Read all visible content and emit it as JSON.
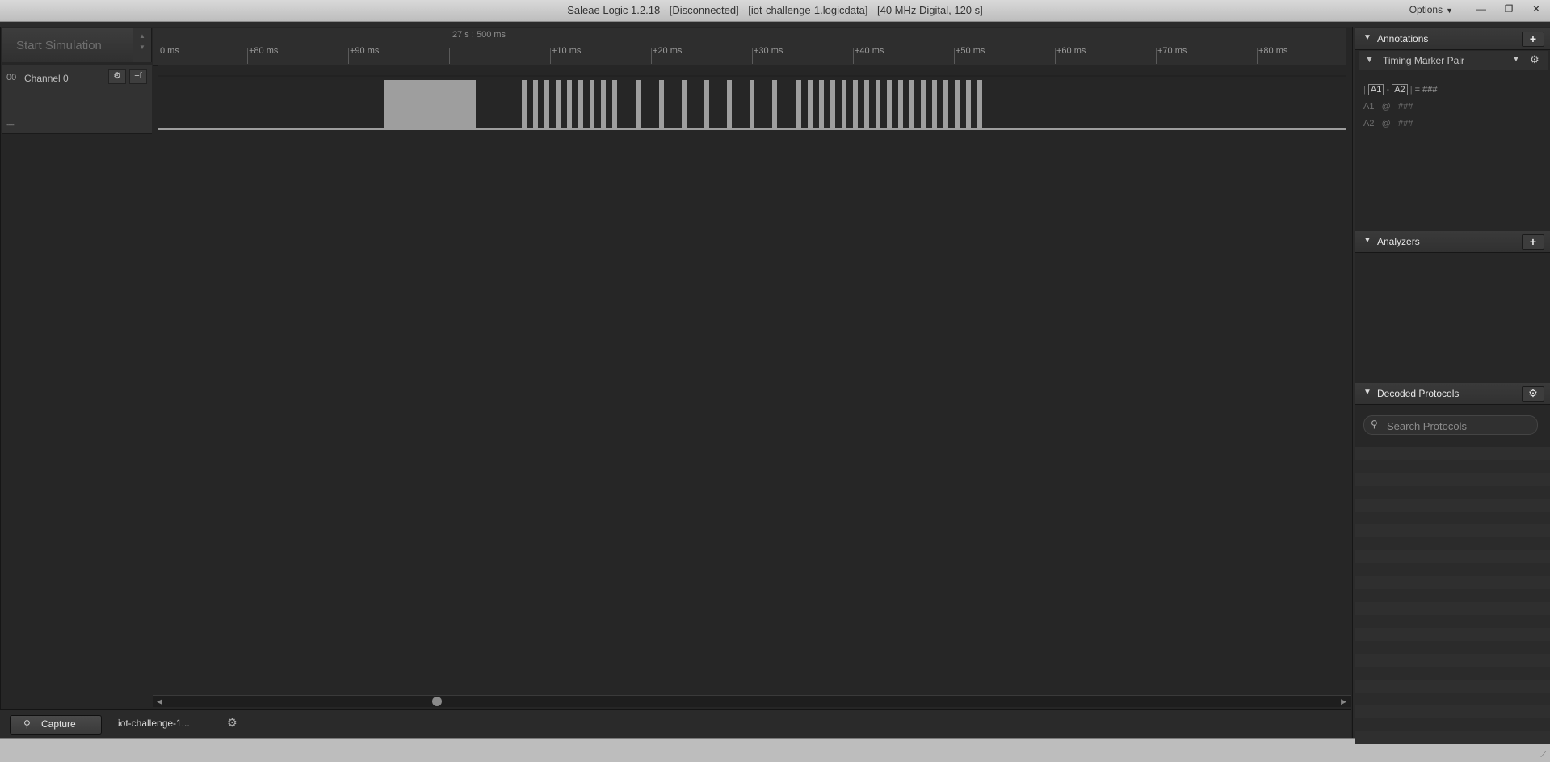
{
  "window": {
    "title": "Saleae Logic 1.2.18 - [Disconnected] - [iot-challenge-1.logicdata] - [40 MHz Digital, 120 s]",
    "options_label": "Options",
    "min_glyph": "—",
    "restore_glyph": "❐",
    "close_glyph": "✕"
  },
  "toolbar": {
    "start_simulation_label": "Start Simulation",
    "arrow_up": "▲",
    "arrow_down": "▼"
  },
  "ruler": {
    "center_time": "27 s : 500 ms",
    "ticks": [
      {
        "label": "0 ms"
      },
      {
        "label": "+80 ms"
      },
      {
        "label": "+90 ms"
      },
      {
        "label": "+10 ms"
      },
      {
        "label": "+20 ms"
      },
      {
        "label": "+30 ms"
      },
      {
        "label": "+40 ms"
      },
      {
        "label": "+50 ms"
      },
      {
        "label": "+60 ms"
      },
      {
        "label": "+70 ms"
      },
      {
        "label": "+80 ms"
      }
    ]
  },
  "channel": {
    "number": "00",
    "name": "Channel 0",
    "settings_glyph": "⚙",
    "add_glyph": "+f"
  },
  "bottom_tabs": {
    "capture_label": "Capture",
    "capture_icon": "search-icon",
    "file_label": "iot-challenge-1...",
    "gear_glyph": "⚙"
  },
  "annotations_panel": {
    "title": "Annotations",
    "add_glyph": "+",
    "timing_marker_label": "Timing Marker Pair",
    "formula": {
      "a1": "A1",
      "a2": "A2",
      "result": "= ###"
    },
    "a1_line": {
      "label": "A1",
      "at": "@",
      "value": "###"
    },
    "a2_line": {
      "label": "A2",
      "at": "@",
      "value": "###"
    }
  },
  "analyzers_panel": {
    "title": "Analyzers",
    "add_glyph": "+"
  },
  "decoded_panel": {
    "title": "Decoded Protocols",
    "gear_glyph": "⚙",
    "search_placeholder": "Search Protocols"
  },
  "colors": {
    "background": "#262626",
    "pulse": "#9e9e9e",
    "title_bar": "#cfcfcf"
  }
}
